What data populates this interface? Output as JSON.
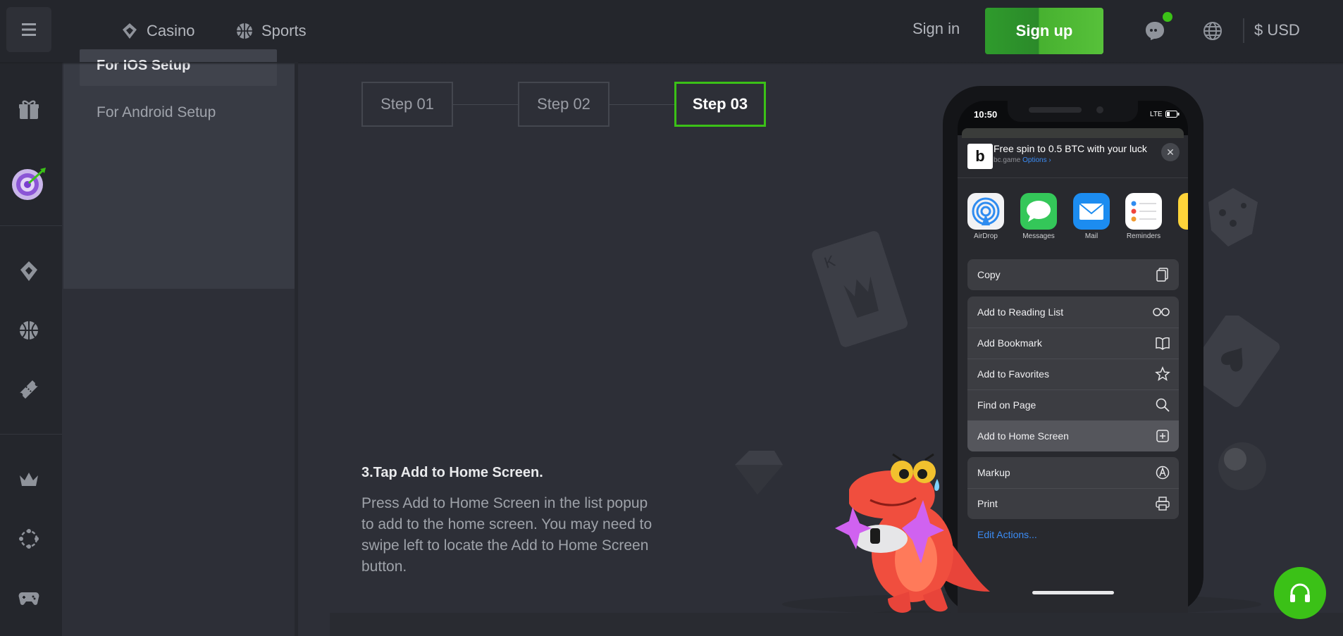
{
  "header": {
    "nav": [
      {
        "label": "Casino",
        "icon": "casino-icon"
      },
      {
        "label": "Sports",
        "icon": "sports-ball-icon"
      }
    ],
    "signin_label": "Sign in",
    "signup_label": "Sign up",
    "currency_label": "$ USD",
    "accent_color": "#3bc117"
  },
  "sidebar_icons": [
    "gift-icon",
    "target-darts-icon",
    "casino-icon",
    "sports-ball-icon",
    "ticket-icon",
    "crown-icon",
    "network-icon",
    "gamepad-icon"
  ],
  "setup_menu": {
    "active_item": "For IOS Setup",
    "item": "For Android Setup"
  },
  "steps": [
    "Step 01",
    "Step 02",
    "Step 03"
  ],
  "active_step": "Step 03",
  "instruction": {
    "title": "3.Tap Add to Home Screen.",
    "body": "Press Add to Home Screen in the list popup to add to the home screen. You may need to swipe left to locate the Add to Home Screen button."
  },
  "phone": {
    "time": "10:50",
    "network": "LTE",
    "share_title": "Free spin to 0.5 BTC with your luck",
    "share_domain": "bc.game",
    "share_options": "Options",
    "apps": [
      "AirDrop",
      "Messages",
      "Mail",
      "Reminders"
    ],
    "actions_primary": [
      {
        "label": "Copy",
        "icon": "copy-icon"
      }
    ],
    "actions": [
      {
        "label": "Add to Reading List",
        "icon": "glasses-icon"
      },
      {
        "label": "Add Bookmark",
        "icon": "book-icon"
      },
      {
        "label": "Add to Favorites",
        "icon": "star-icon"
      },
      {
        "label": "Find on Page",
        "icon": "search-icon"
      },
      {
        "label": "Add to Home Screen",
        "icon": "plus-square-icon"
      }
    ],
    "actions_secondary": [
      {
        "label": "Markup",
        "icon": "markup-icon"
      },
      {
        "label": "Print",
        "icon": "printer-icon"
      }
    ],
    "edit_actions": "Edit Actions..."
  }
}
